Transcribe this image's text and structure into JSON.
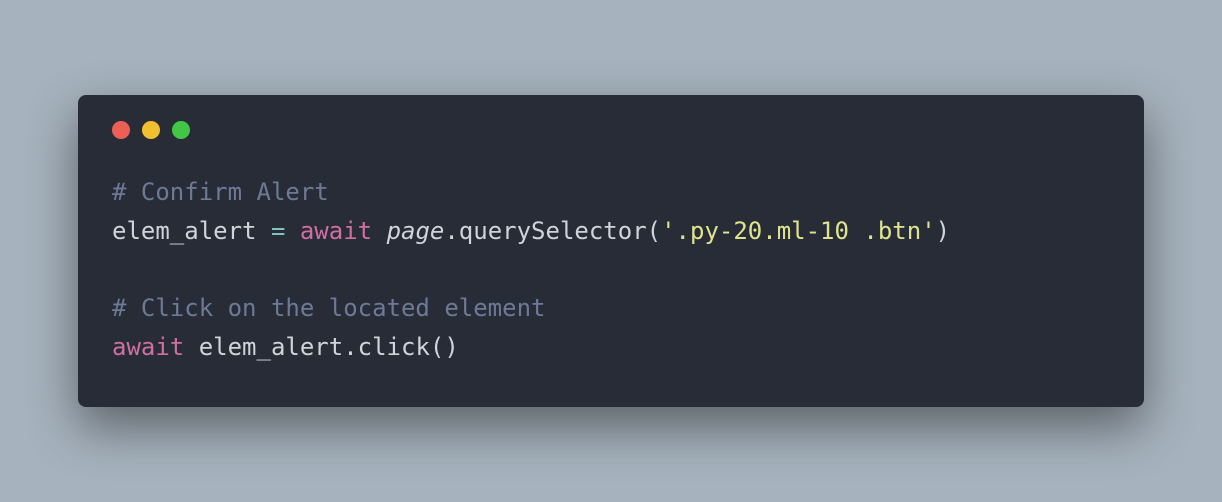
{
  "code": {
    "lines": [
      {
        "tokens": [
          {
            "cls": "tok-comment",
            "text": "# Confirm Alert"
          }
        ]
      },
      {
        "tokens": [
          {
            "cls": "tok-default",
            "text": "elem_alert "
          },
          {
            "cls": "tok-operator",
            "text": "="
          },
          {
            "cls": "tok-default",
            "text": " "
          },
          {
            "cls": "tok-keyword",
            "text": "await"
          },
          {
            "cls": "tok-default",
            "text": " "
          },
          {
            "cls": "tok-italic",
            "text": "page"
          },
          {
            "cls": "tok-default",
            "text": ".querySelector("
          },
          {
            "cls": "tok-string",
            "text": "'.py-20.ml-10 .btn'"
          },
          {
            "cls": "tok-default",
            "text": ")"
          }
        ]
      },
      {
        "tokens": [
          {
            "cls": "tok-default",
            "text": ""
          }
        ]
      },
      {
        "tokens": [
          {
            "cls": "tok-comment",
            "text": "# Click on the located element"
          }
        ]
      },
      {
        "tokens": [
          {
            "cls": "tok-keyword",
            "text": "await"
          },
          {
            "cls": "tok-default",
            "text": " elem_alert.click()"
          }
        ]
      }
    ]
  }
}
